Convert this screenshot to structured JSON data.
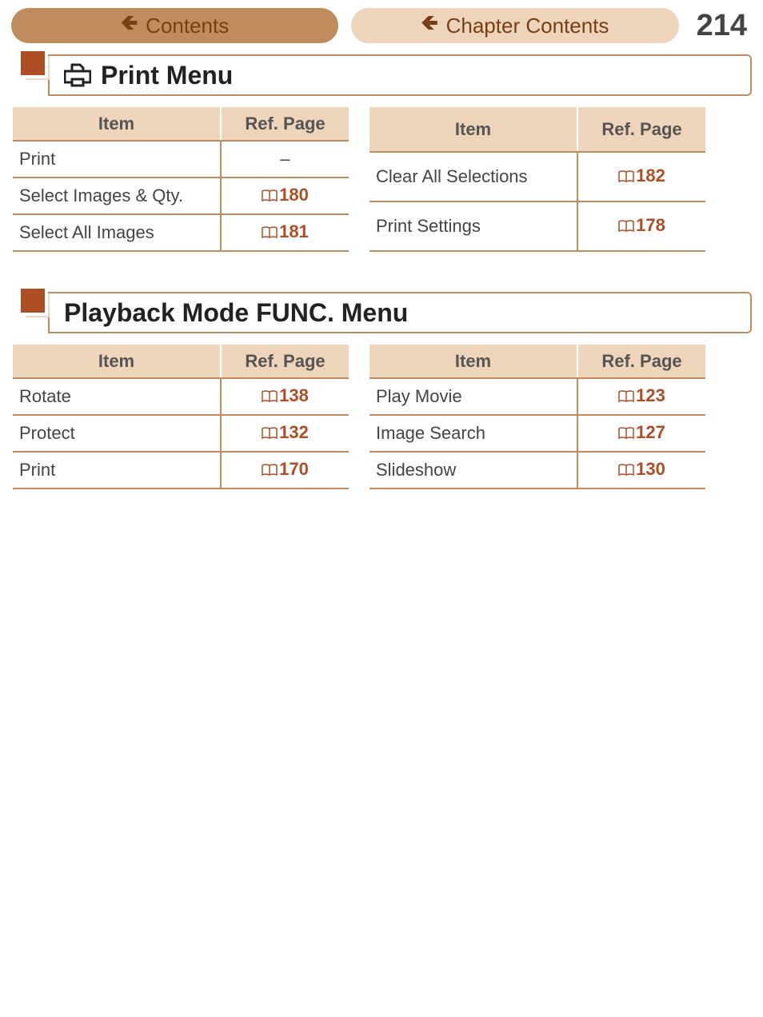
{
  "header": {
    "contents_label": "Contents",
    "chapter_contents_label": "Chapter Contents",
    "page_number": "214"
  },
  "sections": [
    {
      "title": "Print Menu",
      "has_icon": true,
      "tables": [
        {
          "headers": {
            "item": "Item",
            "ref": "Ref. Page"
          },
          "rows": [
            {
              "item": "Print",
              "ref": "–",
              "link": false
            },
            {
              "item": "Select Images & Qty.",
              "ref": "180",
              "link": true
            },
            {
              "item": "Select All Images",
              "ref": "181",
              "link": true
            }
          ]
        },
        {
          "headers": {
            "item": "Item",
            "ref": "Ref. Page"
          },
          "rows": [
            {
              "item": "Clear All Selections",
              "ref": "182",
              "link": true
            },
            {
              "item": "Print Settings",
              "ref": "178",
              "link": true
            }
          ]
        }
      ]
    },
    {
      "title": "Playback Mode FUNC. Menu",
      "has_icon": false,
      "tables": [
        {
          "headers": {
            "item": "Item",
            "ref": "Ref. Page"
          },
          "rows": [
            {
              "item": "Rotate",
              "ref": "138",
              "link": true
            },
            {
              "item": "Protect",
              "ref": "132",
              "link": true
            },
            {
              "item": "Print",
              "ref": "170",
              "link": true
            }
          ]
        },
        {
          "headers": {
            "item": "Item",
            "ref": "Ref. Page"
          },
          "rows": [
            {
              "item": "Play Movie",
              "ref": "123",
              "link": true
            },
            {
              "item": "Image Search",
              "ref": "127",
              "link": true
            },
            {
              "item": "Slideshow",
              "ref": "130",
              "link": true
            }
          ]
        }
      ]
    }
  ]
}
